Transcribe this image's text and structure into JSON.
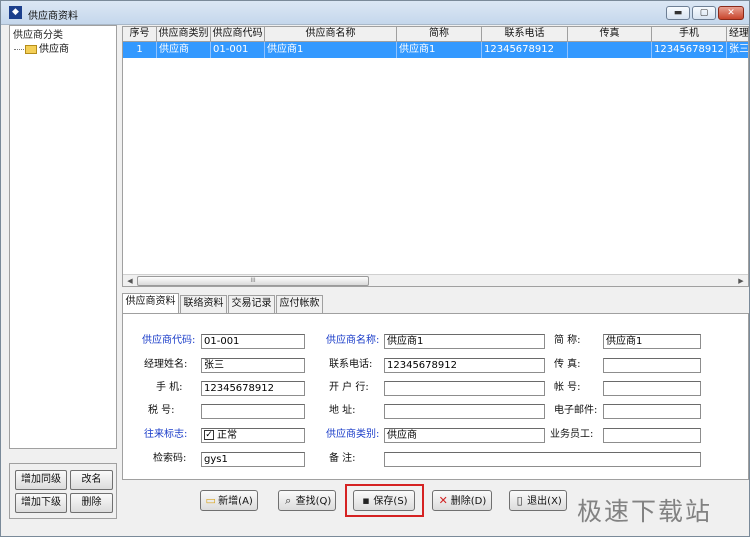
{
  "window": {
    "title": "供应商资料",
    "min_label": "▬",
    "max_label": "▢",
    "close_label": "✕"
  },
  "tree": {
    "header": "供应商分类",
    "root_label": "供应商"
  },
  "left_buttons": {
    "add_sibling": "增加同级",
    "rename": "改名",
    "add_child": "增加下级",
    "delete": "删除"
  },
  "grid": {
    "columns": [
      "序号",
      "供应商类别",
      "供应商代码",
      "供应商名称",
      "简称",
      "联系电话",
      "传真",
      "手机",
      "经理"
    ],
    "rows": [
      [
        "1",
        "供应商",
        "01-001",
        "供应商1",
        "供应商1",
        "12345678912",
        "",
        "12345678912",
        "张三"
      ]
    ],
    "scroll_thumb": "III"
  },
  "tabs": [
    "供应商资料",
    "联络资料",
    "交易记录",
    "应付帐款"
  ],
  "form": {
    "code_label": "供应商代码:",
    "code_value": "01-001",
    "name_label": "供应商名称:",
    "name_value": "供应商1",
    "short_label": "简    称:",
    "short_value": "供应商1",
    "manager_label": "经理姓名:",
    "manager_value": "张三",
    "phone_label": "联系电话:",
    "phone_value": "12345678912",
    "fax_label": "传    真:",
    "fax_value": "",
    "mobile_label": "手    机:",
    "mobile_value": "12345678912",
    "bank_label": "开 户 行:",
    "bank_value": "",
    "account_label": "帐    号:",
    "account_value": "",
    "tax_label": "税    号:",
    "tax_value": "",
    "address_label": "地    址:",
    "address_value": "",
    "email_label": "电子邮件:",
    "email_value": "",
    "flag_label": "往来标志:",
    "flag_value": "正常",
    "category_label": "供应商类别:",
    "category_value": "供应商",
    "staff_label": "业务员工:",
    "staff_value": "",
    "search_label": "检索码:",
    "search_value": "gys1",
    "remark_label": "备    注:",
    "remark_value": ""
  },
  "buttons": {
    "new": "新增(A)",
    "find": "查找(Q)",
    "save": "保存(S)",
    "delete": "删除(D)",
    "exit": "退出(X)"
  },
  "watermark": "极速下载站",
  "colors": {
    "selection": "#3399ff",
    "label_blue": "#1a3cc9",
    "highlight_red": "#d52222"
  }
}
